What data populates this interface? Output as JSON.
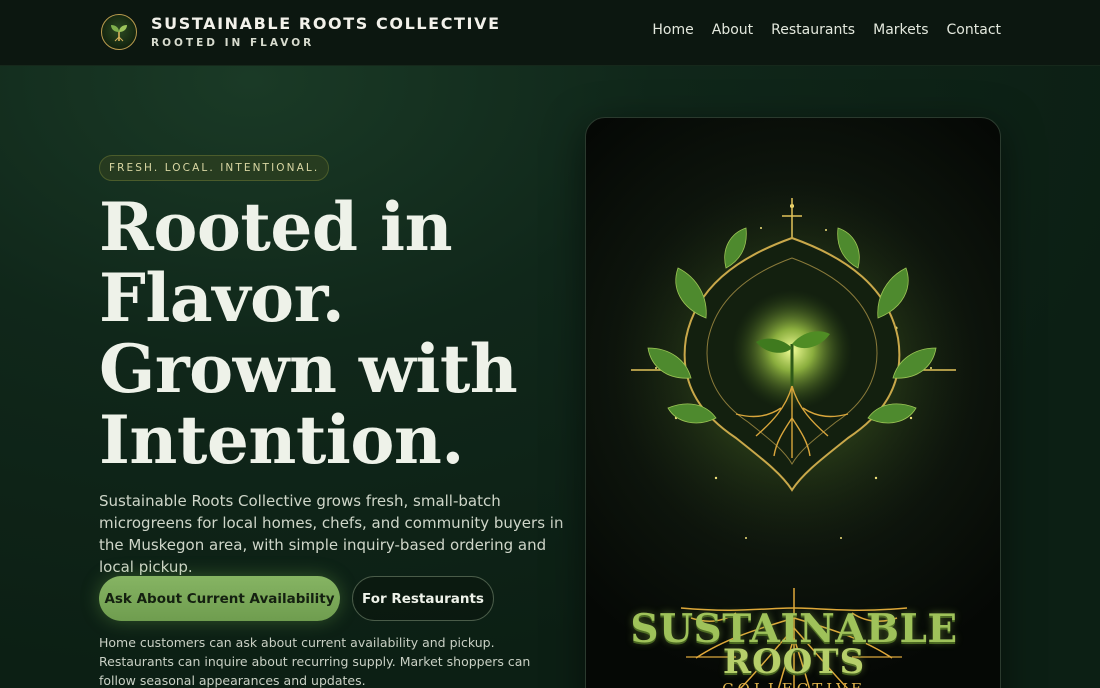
{
  "header": {
    "brand_title": "SUSTAINABLE ROOTS COLLECTIVE",
    "brand_subtitle": "ROOTED IN FLAVOR",
    "logo_icon": "sprout-icon",
    "nav": [
      {
        "label": "Home"
      },
      {
        "label": "About"
      },
      {
        "label": "Restaurants"
      },
      {
        "label": "Markets"
      },
      {
        "label": "Contact"
      }
    ]
  },
  "hero": {
    "eyebrow": "FRESH. LOCAL. INTENTIONAL.",
    "headline_lines": [
      "Rooted in",
      "Flavor.",
      "Grown with",
      "Intention."
    ],
    "lead": "Sustainable Roots Collective grows fresh, small-batch microgreens for local homes, chefs, and community buyers in the Muskegon area, with simple inquiry-based ordering and local pickup.",
    "primary_cta": "Ask About Current Availability",
    "secondary_cta": "For Restaurants",
    "note": "Home customers can ask about current availability and pickup. Restaurants can inquire about recurring supply. Market shoppers can follow seasonal appearances and updates."
  },
  "artwork": {
    "line1": "SUSTAINABLE",
    "line2": "ROOTS",
    "line3": "COLLECTIVE",
    "icon": "sprout-roots-emblem-icon"
  },
  "colors": {
    "background": "#10271a",
    "header": "#0c1710",
    "accent_green": "#7aa957",
    "gold": "#e0b24a",
    "text": "#eef2e9"
  }
}
